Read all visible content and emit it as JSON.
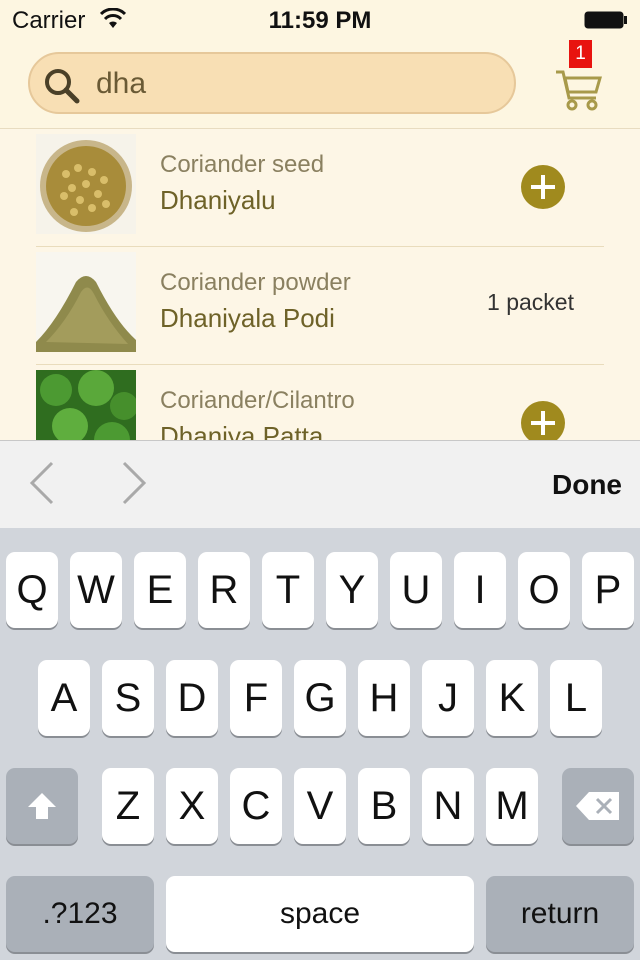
{
  "status_bar": {
    "carrier": "Carrier",
    "time": "11:59 PM"
  },
  "search": {
    "query": "dha"
  },
  "cart": {
    "count": "1"
  },
  "products": [
    {
      "name_en": "Coriander seed",
      "name_te": "Dhaniyalu",
      "action": "add",
      "quantity": ""
    },
    {
      "name_en": "Coriander powder",
      "name_te": "Dhaniyala Podi",
      "action": "quantity",
      "quantity": "1 packet"
    },
    {
      "name_en": "Coriander/Cilantro",
      "name_te": "Dhaniya Patta",
      "action": "add",
      "quantity": ""
    }
  ],
  "accessory": {
    "done_label": "Done"
  },
  "keyboard": {
    "row1": [
      "Q",
      "W",
      "E",
      "R",
      "T",
      "Y",
      "U",
      "I",
      "O",
      "P"
    ],
    "row2": [
      "A",
      "S",
      "D",
      "F",
      "G",
      "H",
      "J",
      "K",
      "L"
    ],
    "row3": [
      "Z",
      "X",
      "C",
      "V",
      "B",
      "N",
      "M"
    ],
    "numbers_label": ".?123",
    "space_label": "space",
    "return_label": "return"
  },
  "colors": {
    "accent": "#a08a1e",
    "badge": "#e8130f",
    "search_bg": "#f8dfb4"
  }
}
